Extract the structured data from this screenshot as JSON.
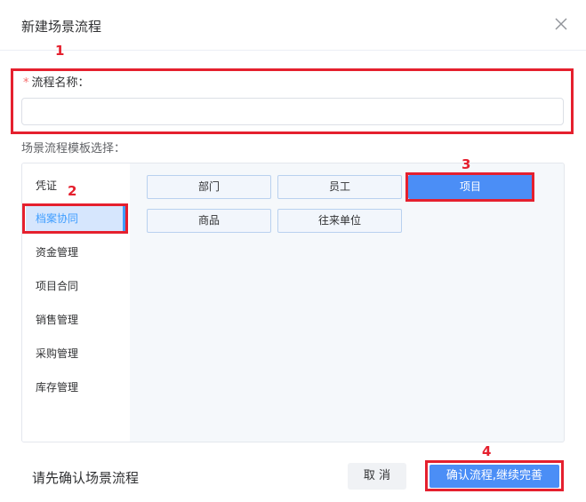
{
  "dialog": {
    "title": "新建场景流程",
    "close_icon": "close-icon"
  },
  "annotations": [
    "1",
    "2",
    "3",
    "4"
  ],
  "form": {
    "required_mark": "*",
    "name_label": "流程名称：",
    "name_value": "",
    "template_label": "场景流程模板选择："
  },
  "categories": [
    {
      "label": "凭证",
      "active": false
    },
    {
      "label": "档案协同",
      "active": true
    },
    {
      "label": "资金管理",
      "active": false
    },
    {
      "label": "项目合同",
      "active": false
    },
    {
      "label": "销售管理",
      "active": false
    },
    {
      "label": "采购管理",
      "active": false
    },
    {
      "label": "库存管理",
      "active": false
    }
  ],
  "templates": [
    {
      "label": "部门",
      "selected": false
    },
    {
      "label": "员工",
      "selected": false
    },
    {
      "label": "项目",
      "selected": true
    },
    {
      "label": "商品",
      "selected": false
    },
    {
      "label": "往来单位",
      "selected": false
    }
  ],
  "footer": {
    "hint": "请先确认场景流程",
    "cancel_label": "取 消",
    "confirm_label": "确认流程,继续完善"
  },
  "colors": {
    "accent": "#4b8ef6",
    "annotation": "#e5202e",
    "active_bg": "#d6e6fd"
  }
}
